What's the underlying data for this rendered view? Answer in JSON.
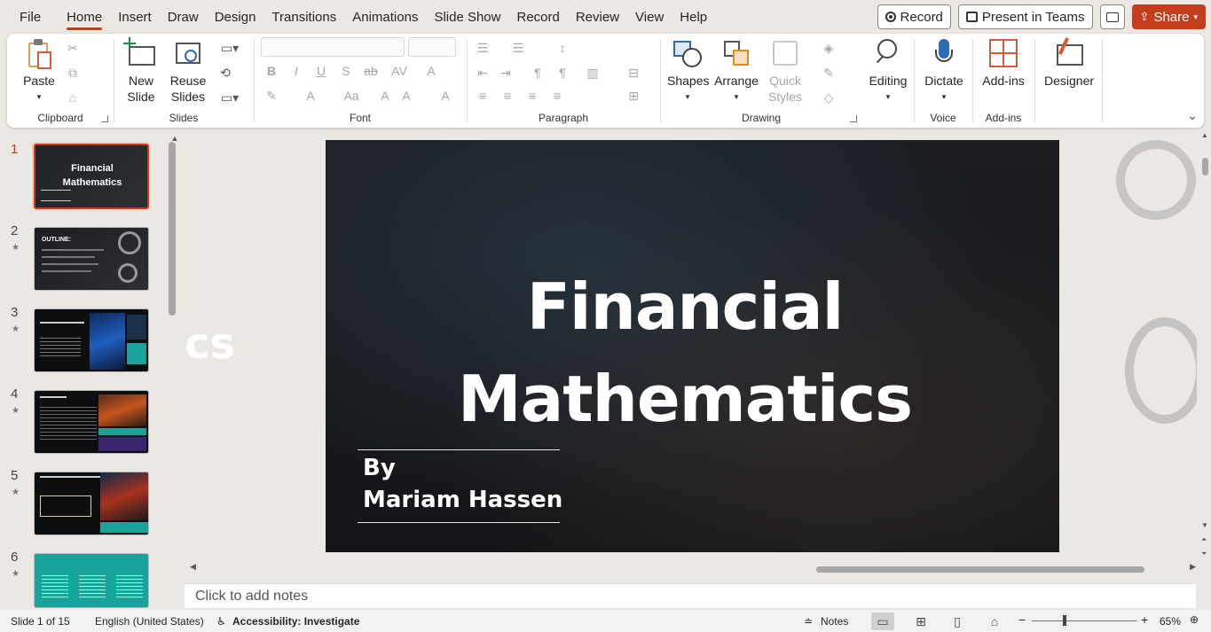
{
  "menu": {
    "tabs": [
      "File",
      "Home",
      "Insert",
      "Draw",
      "Design",
      "Transitions",
      "Animations",
      "Slide Show",
      "Record",
      "Review",
      "View",
      "Help"
    ],
    "active_tab": "Home",
    "record": "Record",
    "present": "Present in Teams",
    "share": "Share"
  },
  "ribbon": {
    "clipboard": {
      "paste": "Paste",
      "label": "Clipboard"
    },
    "slides": {
      "new_slide_1": "New",
      "new_slide_2": "Slide",
      "reuse_1": "Reuse",
      "reuse_2": "Slides",
      "label": "Slides"
    },
    "font": {
      "label": "Font"
    },
    "paragraph": {
      "label": "Paragraph"
    },
    "drawing": {
      "shapes": "Shapes",
      "arrange": "Arrange",
      "quick_1": "Quick",
      "quick_2": "Styles",
      "label": "Drawing"
    },
    "editing": {
      "label": "Editing"
    },
    "voice": {
      "dictate": "Dictate",
      "label": "Voice"
    },
    "addins": {
      "addins": "Add-ins",
      "label": "Add-ins"
    },
    "designer": {
      "label": "Designer"
    }
  },
  "thumbnails": [
    {
      "num": "1",
      "title": "Financial Mathematics"
    },
    {
      "num": "2",
      "title": "OUTLINE:"
    },
    {
      "num": "3",
      "title": ""
    },
    {
      "num": "4",
      "title": ""
    },
    {
      "num": "5",
      "title": ""
    },
    {
      "num": "6",
      "title": ""
    }
  ],
  "slide": {
    "title_1": "Financial",
    "title_2": "Mathematics",
    "by": "By",
    "author": "Mariam Hassen",
    "offscreen_text": "cs"
  },
  "notes_placeholder": "Click to add notes",
  "status": {
    "slide_count": "Slide 1 of 15",
    "language": "English (United States)",
    "accessibility": "Accessibility: Investigate",
    "notes": "Notes",
    "zoom": "65%"
  },
  "colors": {
    "accent": "#c43e1c",
    "ribbon_bg": "#ffffff",
    "canvas_bg": "#ebe7e3"
  }
}
